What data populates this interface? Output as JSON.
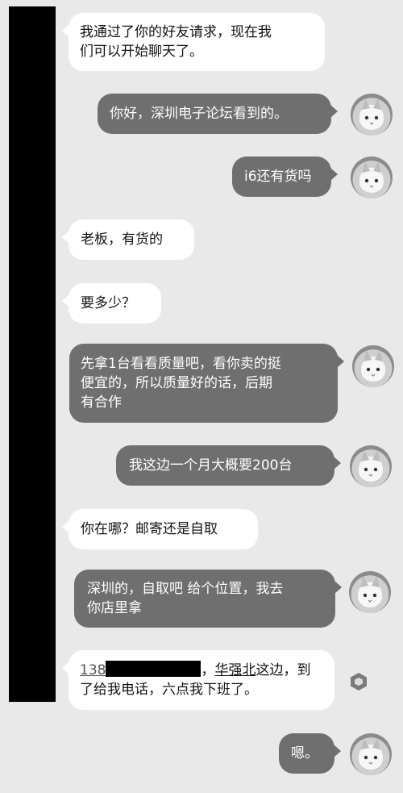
{
  "messages": [
    {
      "side": "left",
      "text": "我通过了你的好友请求，现在我\n们可以开始聊天了。"
    },
    {
      "side": "right",
      "text": "你好，深圳电子论坛看到的。"
    },
    {
      "side": "right",
      "text": "i6还有货吗"
    },
    {
      "side": "left",
      "text": "老板，有货的"
    },
    {
      "side": "left",
      "text": "要多少？"
    },
    {
      "side": "right",
      "text": "先拿1台看看质量吧，看你卖的挺\n便宜的，所以质量好的话，后期\n有合作"
    },
    {
      "side": "right",
      "text": "我这边一个月大概要200台"
    },
    {
      "side": "left",
      "text": "你在哪？邮寄还是自取"
    },
    {
      "side": "right",
      "text": "深圳的，自取吧 给个位置，我去\n你店里拿"
    },
    {
      "side": "left",
      "phone_prefix": "138",
      "after_redaction": "，",
      "location_link": "华强北",
      "text_rest": "这边，到\n了给我电话，六点我下班了。"
    },
    {
      "side": "right",
      "text": "嗯。"
    }
  ],
  "avatar_icon": "cat-avatar-icon",
  "pending_icon": "hexagon-icon",
  "colors": {
    "sent_bubble": "#6f6f6f",
    "received_bubble": "#ffffff",
    "background": "#e9e9e9"
  }
}
